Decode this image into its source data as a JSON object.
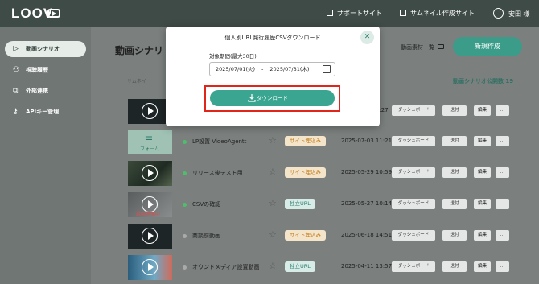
{
  "topbar": {
    "logo": "LOOV",
    "links": [
      "サポートサイト",
      "サムネイル作成サイト"
    ],
    "user_name": "安田 様"
  },
  "sidebar": {
    "items": [
      {
        "label": "動画シナリオ",
        "icon": "play-icon",
        "active": true
      },
      {
        "label": "視聴履歴",
        "icon": "users-icon",
        "active": false
      },
      {
        "label": "外部連携",
        "icon": "external-link-icon",
        "active": false
      },
      {
        "label": "APIキー管理",
        "icon": "key-icon",
        "active": false
      }
    ]
  },
  "main": {
    "page_title": "動画シナリ",
    "material_link": "動画素材一覧",
    "new_button": "新規作成",
    "tab_partial": "サムネイ",
    "public_count": "動画シナリオ公開数 19"
  },
  "rows": [
    {
      "thumb": "dark",
      "title": "",
      "badge": "",
      "badge_color": "",
      "date": "0:27",
      "status": "active",
      "buttons": [
        "ダッシュボード",
        "送付",
        "編集",
        "…"
      ]
    },
    {
      "thumb": "form",
      "thumb_label": "フォーム",
      "title": "LP設置 VideoAgentt",
      "badge": "サイト埋込み",
      "badge_color": "orange",
      "date": "2025-07-03 11:21",
      "status": "active",
      "buttons": [
        "ダッシュボード",
        "送付",
        "編集",
        "…"
      ]
    },
    {
      "thumb": "forest",
      "title": "リリース後テスト用",
      "badge": "サイト埋込み",
      "badge_color": "orange",
      "date": "2025-05-29 10:59",
      "status": "active",
      "buttons": [
        "ダッシュボード",
        "送付",
        "編集",
        "…"
      ]
    },
    {
      "thumb": "face",
      "thumb_label": "録画準備中",
      "title": "CSVの確認",
      "badge": "独立URL",
      "badge_color": "teal",
      "date": "2025-05-27 10:14",
      "status": "active",
      "buttons": [
        "ダッシュボード",
        "送付",
        "編集",
        "…"
      ]
    },
    {
      "thumb": "dark",
      "title": "商談前動画",
      "badge": "サイト埋込み",
      "badge_color": "orange",
      "date": "2025-06-18 14:51",
      "status": "inactive",
      "buttons": [
        "ダッシュボード",
        "送付",
        "編集",
        "…"
      ]
    },
    {
      "thumb": "colorful",
      "title": "オウンドメディア設置動画",
      "badge": "独立URL",
      "badge_color": "teal",
      "date": "2025-04-11 13:57",
      "status": "inactive",
      "buttons": [
        "ダッシュボード",
        "送付",
        "編集",
        "…"
      ]
    }
  ],
  "modal": {
    "title": "個人別URL発行履歴CSVダウンロード",
    "period_label": "対象期間(最大30日)",
    "start_date": "2025/07/01(火)",
    "separator": "-",
    "end_date": "2025/07/31(木)",
    "download_button": "ダウンロード"
  },
  "colors": {
    "accent": "#3aa590",
    "highlight": "#e0251b"
  }
}
